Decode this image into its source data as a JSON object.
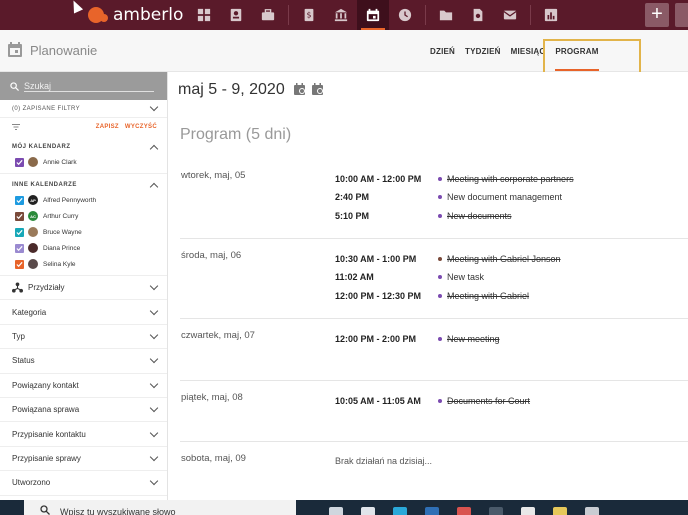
{
  "app": {
    "logo_text": "amberlo"
  },
  "topnav": {
    "icons": [
      "dashboard-icon",
      "contacts-icon",
      "briefcase-icon",
      "billing-icon",
      "bank-icon",
      "calendar-icon",
      "time-icon",
      "folder-icon",
      "document-search-icon",
      "mail-icon",
      "reports-icon"
    ],
    "active": "calendar-icon",
    "plus_label": "+"
  },
  "header": {
    "title": "Planowanie",
    "tabs": [
      {
        "label": "DZIEŃ",
        "active": false
      },
      {
        "label": "TYDZIEŃ",
        "active": false
      },
      {
        "label": "MIESIĄC",
        "active": false
      },
      {
        "label": "PROGRAM",
        "active": true
      }
    ]
  },
  "sidebar": {
    "search_placeholder": "Szukaj",
    "saved_filters": "(0) ZAPISANE FILTRY",
    "save_label": "ZAPISZ",
    "clear_label": "WYCZYŚĆ",
    "my_calendar_title": "MÓJ KALENDARZ",
    "my_calendars": [
      {
        "name": "Annie Clark",
        "color": "#7b4bb0",
        "avatar_color": "#8a6a4a",
        "initials": ""
      }
    ],
    "other_calendars_title": "INNE KALENDARZE",
    "other_calendars": [
      {
        "name": "Alfred Pennyworth",
        "color": "#1e9be0",
        "avatar_color": "#222222",
        "initials": "AP"
      },
      {
        "name": "Arthur Curry",
        "color": "#7a4a3a",
        "avatar_color": "#2a8a3a",
        "initials": "AC"
      },
      {
        "name": "Bruce Wayne",
        "color": "#17a8b8",
        "avatar_color": "#9a7a5a",
        "initials": ""
      },
      {
        "name": "Diana Prince",
        "color": "#9a8ad0",
        "avatar_color": "#4a2a2a",
        "initials": ""
      },
      {
        "name": "Selina Kyle",
        "color": "#e8642a",
        "avatar_color": "#5a4a4a",
        "initials": ""
      }
    ],
    "filters": [
      {
        "label": "Przydziały",
        "icon": "assignment-icon"
      },
      {
        "label": "Kategoria"
      },
      {
        "label": "Typ"
      },
      {
        "label": "Status"
      },
      {
        "label": "Powiązany kontakt"
      },
      {
        "label": "Powiązana sprawa"
      },
      {
        "label": "Przypisanie kontaktu"
      },
      {
        "label": "Przypisanie sprawy"
      },
      {
        "label": "Utworzono"
      }
    ]
  },
  "main": {
    "date_range": "maj 5 - 9, 2020",
    "program_title": "Program (5 dni)",
    "days": [
      {
        "name": "wtorek, maj, 05",
        "events": [
          {
            "time": "10:00 AM - 12:00 PM",
            "title": "Meeting with corporate partners",
            "done": true,
            "color": "#7b4bb0"
          },
          {
            "time": "2:40 PM",
            "title": "New document management",
            "done": false,
            "color": "#7b4bb0"
          },
          {
            "time": "5:10 PM",
            "title": "New documents",
            "done": true,
            "color": "#7b4bb0"
          }
        ]
      },
      {
        "name": "środa, maj, 06",
        "events": [
          {
            "time": "10:30 AM - 1:00 PM",
            "title": "Meeting with Gabriel Jonson",
            "done": true,
            "color": "#7a4a3a"
          },
          {
            "time": "11:02 AM",
            "title": "New task",
            "done": false,
            "color": "#7b4bb0"
          },
          {
            "time": "12:00 PM - 12:30 PM",
            "title": "Meeting with Gabriel",
            "done": true,
            "color": "#7b4bb0"
          }
        ]
      },
      {
        "name": "czwartek, maj, 07",
        "events": [
          {
            "time": "12:00 PM - 2:00 PM",
            "title": "New meeting",
            "done": true,
            "color": "#7b4bb0"
          }
        ]
      },
      {
        "name": "piątek, maj, 08",
        "events": [
          {
            "time": "10:05 AM - 11:05 AM",
            "title": "Documents for Court",
            "done": true,
            "color": "#7b4bb0"
          }
        ]
      },
      {
        "name": "sobota, maj, 09",
        "events": [],
        "empty_text": "Brak działań na dzisiaj..."
      }
    ]
  },
  "taskbar": {
    "search_text": "Wpisz tu wyszukiwane słowo"
  }
}
